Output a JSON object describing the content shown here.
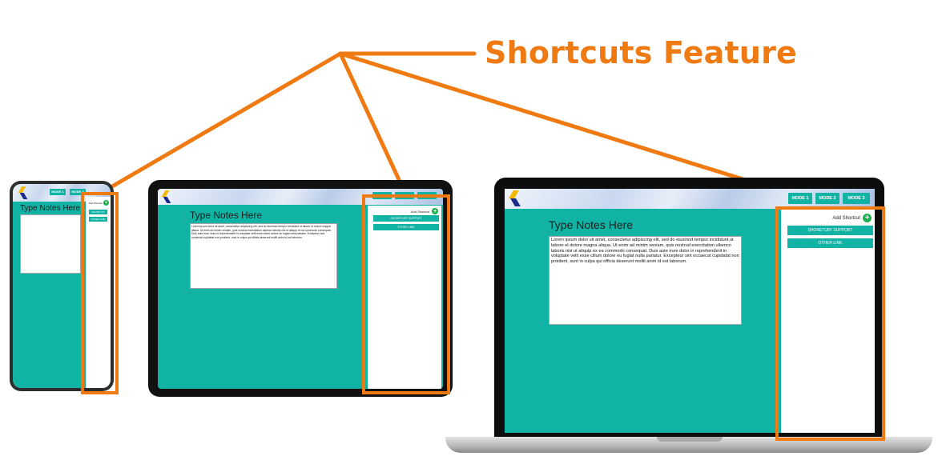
{
  "callout": {
    "title": "Shortcuts Feature",
    "color": "#f07a12"
  },
  "app": {
    "brand_colors": {
      "teal": "#10b3a4",
      "add_green": "#19b14b",
      "logo_yellow": "#f5b700",
      "logo_navy": "#1b2c8a"
    },
    "logo_icon": "brand-s-logo",
    "notes_title": "Type Notes Here",
    "notes_text": "Lorem ipsum dolor sit amet, consectetur adipiscing elit, sed do eiusmod tempor incididunt ut labore et dolore magna aliqua. Ut enim ad minim veniam, quis nostrud exercitation ullamco laboris nisi ut aliquip ex ea commodo consequat. Duis aute irure dolor in reprehenderit in voluptate velit esse cillum dolore eu fugiat nulla pariatur. Excepteur sint occaecat cupidatat non proident, sunt in culpa qui officia deserunt mollit anim id est laborum.",
    "modes": [
      "MODE 1",
      "MODE 2",
      "MODE 3"
    ],
    "add_shortcut_label": "Add Shortcut",
    "add_icon": "plus-icon",
    "shortcuts": [
      "SHORETUFF SUPPORT",
      "OTHER LINK"
    ]
  },
  "phone": {
    "modes": [
      "MODE 1",
      "MODE 2"
    ],
    "add_shortcut_label": "Add Shortcut",
    "shortcuts": [
      "SHORTCUT",
      "OTHER LINK"
    ]
  }
}
